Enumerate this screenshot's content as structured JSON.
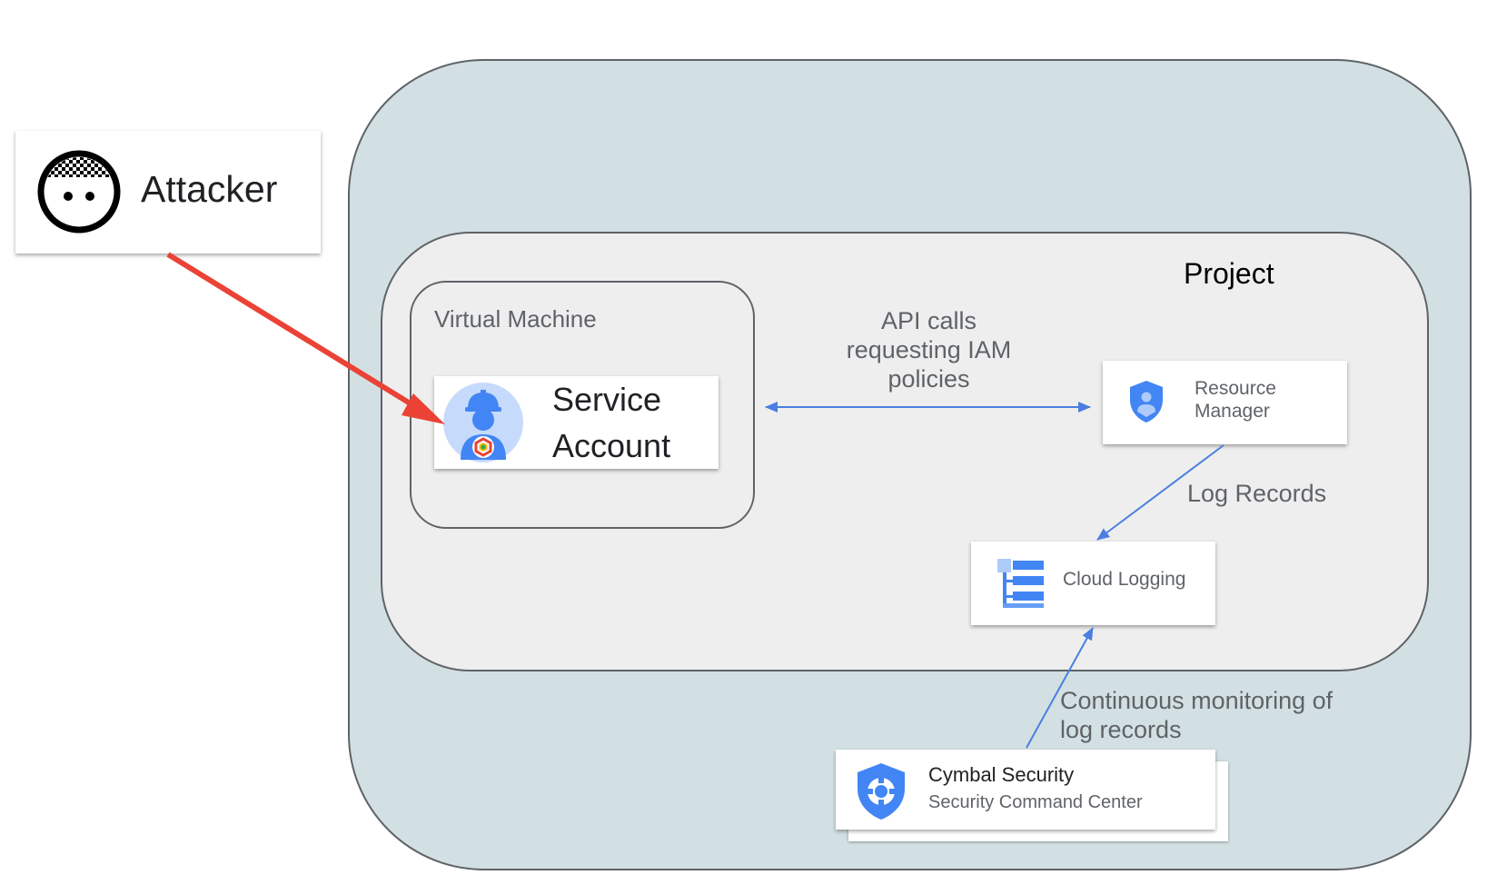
{
  "nodes": {
    "attacker": {
      "label": "Attacker"
    },
    "project": {
      "label": "Project"
    },
    "virtual_machine": {
      "label": "Virtual Machine"
    },
    "service_account": {
      "label": "Service Account"
    },
    "resource_manager": {
      "label": "Resource Manager"
    },
    "cloud_logging": {
      "label": "Cloud Logging"
    },
    "security_command_center": {
      "title": "Cymbal Security",
      "subtitle": "Security Command Center"
    }
  },
  "edges": {
    "api_calls": {
      "label": "API calls requesting IAM policies"
    },
    "log_records": {
      "label": "Log Records"
    },
    "monitoring": {
      "label": "Continuous monitoring of log records"
    }
  },
  "colors": {
    "outer_fill": "#d3e0e3",
    "project_fill": "#eeeeee",
    "border": "#5f6368",
    "attack_arrow": "#ea4335",
    "flow_arrow": "#4a7fe0",
    "icon_blue": "#4285f4",
    "icon_light_blue": "#aecbfa"
  }
}
